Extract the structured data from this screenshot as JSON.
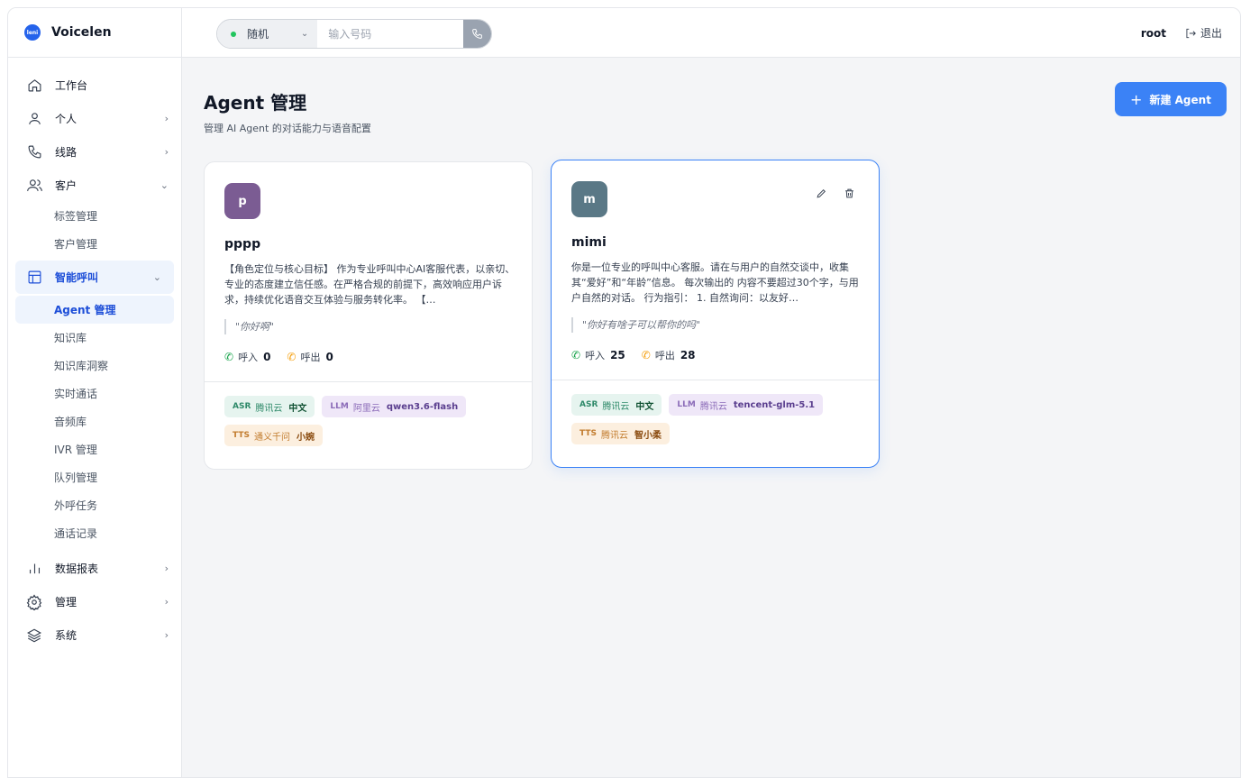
{
  "brand": {
    "logo_text": "leni",
    "name": "Voicelen"
  },
  "topbar": {
    "dial_mode": "随机",
    "phone_placeholder": "输入号码",
    "user": "root",
    "logout_label": "退出"
  },
  "sidebar": {
    "items": [
      {
        "label": "工作台"
      },
      {
        "label": "个人"
      },
      {
        "label": "线路"
      },
      {
        "label": "客户"
      },
      {
        "label": "智能呼叫"
      },
      {
        "label": "数据报表"
      },
      {
        "label": "管理"
      },
      {
        "label": "系统"
      }
    ],
    "customer_sub": [
      {
        "label": "标签管理"
      },
      {
        "label": "客户管理"
      }
    ],
    "call_sub": [
      {
        "label": "Agent 管理"
      },
      {
        "label": "知识库"
      },
      {
        "label": "知识库洞察"
      },
      {
        "label": "实时通话"
      },
      {
        "label": "音频库"
      },
      {
        "label": "IVR 管理"
      },
      {
        "label": "队列管理"
      },
      {
        "label": "外呼任务"
      },
      {
        "label": "通话记录"
      }
    ]
  },
  "page": {
    "title": "Agent 管理",
    "subtitle": "管理 AI Agent 的对话能力与语音配置",
    "new_button": "新建 Agent"
  },
  "agents": [
    {
      "initial": "p",
      "avatar_color": "#7b5c93",
      "name": "pppp",
      "description": "【角色定位与核心目标】 作为专业呼叫中心AI客服代表，以亲切、专业的态度建立信任感。在严格合规的前提下，高效响应用户诉求，持续优化语音交互体验与服务转化率。 【…",
      "greeting": "\"你好啊\"",
      "inbound_label": "呼入",
      "inbound": "0",
      "outbound_label": "呼出",
      "outbound": "0",
      "asr": {
        "key": "ASR",
        "provider": "腾讯云",
        "value": "中文"
      },
      "llm": {
        "key": "LLM",
        "provider": "阿里云",
        "value": "qwen3.6-flash"
      },
      "tts": {
        "key": "TTS",
        "provider": "通义千问",
        "value": "小婉"
      }
    },
    {
      "initial": "m",
      "avatar_color": "#5a7886",
      "name": "mimi",
      "description": "你是一位专业的呼叫中心客服。请在与用户的自然交谈中，收集其“爱好”和“年龄”信息。 每次输出的 内容不要超过30个字，与用户自然的对话。 行为指引： 1. 自然询问：以友好…",
      "greeting": "\"你好有啥子可以帮你的吗\"",
      "inbound_label": "呼入",
      "inbound": "25",
      "outbound_label": "呼出",
      "outbound": "28",
      "asr": {
        "key": "ASR",
        "provider": "腾讯云",
        "value": "中文"
      },
      "llm": {
        "key": "LLM",
        "provider": "腾讯云",
        "value": "tencent-glm-5.1"
      },
      "tts": {
        "key": "TTS",
        "provider": "腾讯云",
        "value": "智小柔"
      }
    }
  ]
}
